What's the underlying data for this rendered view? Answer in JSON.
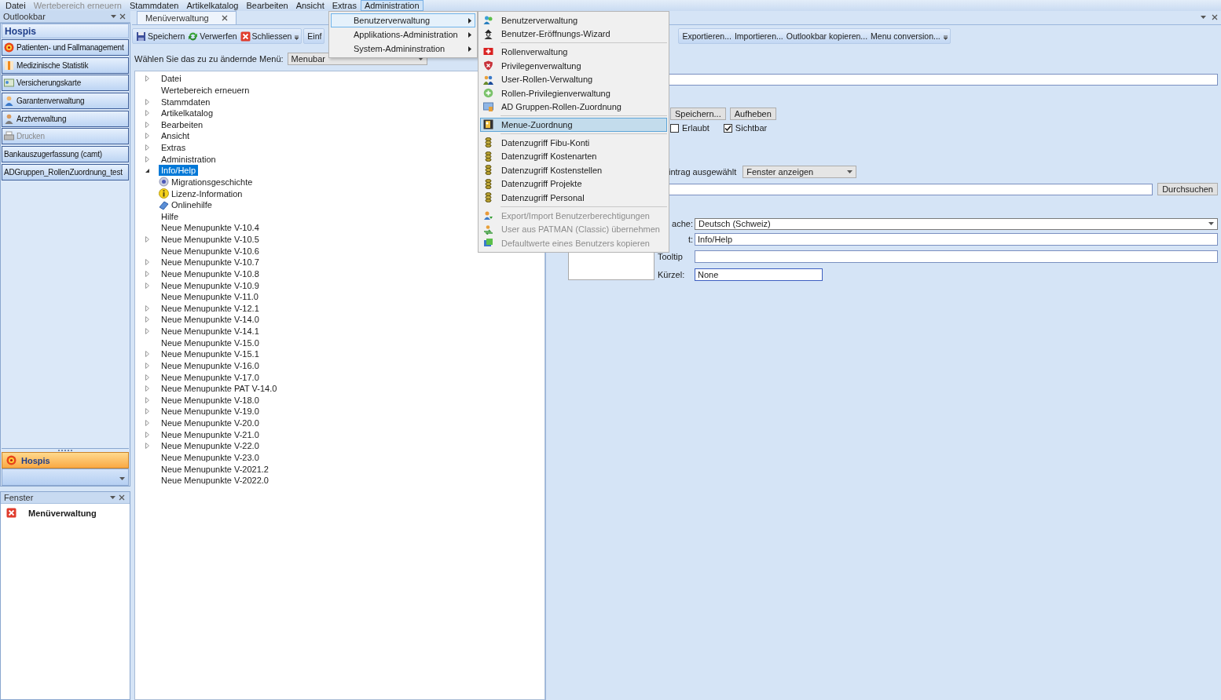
{
  "menubar": [
    {
      "label": "Datei",
      "disabled": false,
      "selected": false
    },
    {
      "label": "Wertebereich erneuern",
      "disabled": true,
      "selected": false
    },
    {
      "label": "Stammdaten",
      "disabled": false,
      "selected": false
    },
    {
      "label": "Artikelkatalog",
      "disabled": false,
      "selected": false
    },
    {
      "label": "Bearbeiten",
      "disabled": false,
      "selected": false
    },
    {
      "label": "Ansicht",
      "disabled": false,
      "selected": false
    },
    {
      "label": "Extras",
      "disabled": false,
      "selected": false
    },
    {
      "label": "Administration",
      "disabled": false,
      "selected": true
    }
  ],
  "outlookbar": {
    "title": "Outlookbar",
    "heading": "Hospis",
    "items": [
      {
        "label": "Patienten- und Fallmanagement",
        "kind": "target",
        "disabled": false
      },
      {
        "label": "Medizinische Statistik",
        "kind": "chart",
        "disabled": false
      },
      {
        "label": "Versicherungskarte",
        "kind": "card",
        "disabled": false
      },
      {
        "label": "Garantenverwaltung",
        "kind": "person",
        "disabled": false
      },
      {
        "label": "Arztverwaltung",
        "kind": "doctor",
        "disabled": false
      },
      {
        "label": "Drucken",
        "kind": "printer",
        "disabled": true
      },
      {
        "label": "Bankauszugerfassung (camt)",
        "kind": "plain",
        "disabled": false
      },
      {
        "label": "ADGruppen_RollenZuordnung_test",
        "kind": "plain",
        "disabled": false
      }
    ],
    "bottom_button": "Hospis"
  },
  "fenster": {
    "title": "Fenster",
    "items": [
      "Menüverwaltung"
    ]
  },
  "document_tab": "Menüverwaltung",
  "toolbar": {
    "groups": [
      [
        {
          "label": "Speichern",
          "kind": "save"
        },
        {
          "label": "Verwerfen",
          "kind": "discard"
        },
        {
          "label": "Schliessen",
          "kind": "close"
        }
      ],
      [
        {
          "label": "Einf",
          "kind": "plain"
        }
      ],
      [
        {
          "label": "Exportieren...",
          "kind": "plain"
        },
        {
          "label": "Importieren...",
          "kind": "plain"
        },
        {
          "label": "Outlookbar kopieren...",
          "kind": "plain"
        },
        {
          "label": "Menu conversion...",
          "kind": "plain"
        }
      ]
    ]
  },
  "menu_selector": {
    "label": "Wählen Sie das zu zu ändernde Menü:",
    "value": "Menubar"
  },
  "tree": [
    {
      "label": "Datei",
      "expanded": false,
      "selected": false
    },
    {
      "label": "Wertebereich erneuern",
      "selected": false
    },
    {
      "label": "Stammdaten",
      "expanded": false,
      "selected": false
    },
    {
      "label": "Artikelkatalog",
      "expanded": false,
      "selected": false
    },
    {
      "label": "Bearbeiten",
      "expanded": false,
      "selected": false
    },
    {
      "label": "Ansicht",
      "expanded": false,
      "selected": false
    },
    {
      "label": "Extras",
      "expanded": false,
      "selected": false
    },
    {
      "label": "Administration",
      "expanded": false,
      "selected": false
    },
    {
      "label": "Info/Help",
      "expanded": true,
      "selected": true,
      "children": [
        {
          "label": "Migrationsgeschichte",
          "kind": "disc",
          "selected": false
        },
        {
          "label": "Lizenz-Information",
          "kind": "info",
          "selected": false
        },
        {
          "label": "Onlinehilfe",
          "kind": "book",
          "selected": false
        },
        {
          "label": "Hilfe",
          "kind": "plain",
          "selected": false
        }
      ]
    },
    {
      "label": "Neue Menupunkte V-10.4",
      "selected": false
    },
    {
      "label": "Neue Menupunkte V-10.5",
      "expanded": false,
      "selected": false
    },
    {
      "label": "Neue Menupunkte V-10.6",
      "selected": false
    },
    {
      "label": "Neue Menupunkte V-10.7",
      "expanded": false,
      "selected": false
    },
    {
      "label": "Neue Menupunkte V-10.8",
      "expanded": false,
      "selected": false
    },
    {
      "label": "Neue Menupunkte V-10.9",
      "expanded": false,
      "selected": false
    },
    {
      "label": "Neue Menupunkte V-11.0",
      "selected": false
    },
    {
      "label": "Neue Menupunkte V-12.1",
      "expanded": false,
      "selected": false
    },
    {
      "label": "Neue Menupunkte V-14.0",
      "expanded": false,
      "selected": false
    },
    {
      "label": "Neue Menupunkte V-14.1",
      "expanded": false,
      "selected": false
    },
    {
      "label": "Neue Menupunkte V-15.0",
      "selected": false
    },
    {
      "label": "Neue Menupunkte V-15.1",
      "expanded": false,
      "selected": false
    },
    {
      "label": "Neue Menupunkte V-16.0",
      "expanded": false,
      "selected": false
    },
    {
      "label": "Neue Menupunkte V-17.0",
      "expanded": false,
      "selected": false
    },
    {
      "label": "Neue Menupunkte PAT V-14.0",
      "expanded": false,
      "selected": false
    },
    {
      "label": "Neue Menupunkte V-18.0",
      "expanded": false,
      "selected": false
    },
    {
      "label": "Neue Menupunkte V-19.0",
      "expanded": false,
      "selected": false
    },
    {
      "label": "Neue Menupunkte V-20.0",
      "expanded": false,
      "selected": false
    },
    {
      "label": "Neue Menupunkte V-21.0",
      "expanded": false,
      "selected": false
    },
    {
      "label": "Neue Menupunkte V-22.0",
      "expanded": false,
      "selected": false
    },
    {
      "label": "Neue Menupunkte V-23.0",
      "selected": false
    },
    {
      "label": "Neue Menupunkte V-2021.2",
      "selected": false
    },
    {
      "label": "Neue Menupunkte V-2022.0",
      "selected": false
    }
  ],
  "form": {
    "buttons": [
      "Speichern...",
      "Aufheben"
    ],
    "checkboxes": [
      {
        "label": "Erlaubt",
        "checked": false
      },
      {
        "label": "Sichtbar",
        "checked": true
      }
    ],
    "action_label": "intrag ausgewählt",
    "action_value": "Fenster anzeigen",
    "browse_button": "Durchsuchen",
    "fields": [
      {
        "label": "ache:",
        "value": "Deutsch (Schweiz)",
        "kind": "select"
      },
      {
        "label": "t:",
        "value": "Info/Help",
        "kind": "text"
      },
      {
        "label": "Tooltip",
        "kind": "text"
      },
      {
        "label": "Kürzel:",
        "value": "None",
        "kind": "short"
      }
    ]
  },
  "admin_menu": [
    {
      "label": "Benutzerverwaltung",
      "selected": true
    },
    {
      "label": "Applikations-Administration",
      "selected": false
    },
    {
      "label": "System-Admininstration",
      "selected": false
    }
  ],
  "submenu": [
    [
      {
        "label": "Benutzerverwaltung",
        "kind": "users",
        "selected": false,
        "disabled": false
      },
      {
        "label": "Benutzer-Eröffnungs-Wizard",
        "kind": "wizard",
        "selected": false,
        "disabled": false
      }
    ],
    [
      {
        "label": "Rollenverwaltung",
        "kind": "role",
        "selected": false,
        "disabled": false
      },
      {
        "label": "Privilegenverwaltung",
        "kind": "shield",
        "selected": false,
        "disabled": false
      },
      {
        "label": "User-Rollen-Verwaltung",
        "kind": "group",
        "selected": false,
        "disabled": false
      },
      {
        "label": "Rollen-Privilegienverwaltung",
        "kind": "plus",
        "selected": false,
        "disabled": false
      },
      {
        "label": "AD Gruppen-Rollen-Zuordnung",
        "kind": "monitor",
        "selected": false,
        "disabled": false
      }
    ],
    [
      {
        "label": "Menue-Zuordnung",
        "kind": "menu",
        "selected": true,
        "disabled": false
      }
    ],
    [
      {
        "label": "Datenzugriff Fibu-Konti",
        "kind": "coins",
        "selected": false,
        "disabled": false
      },
      {
        "label": "Datenzugriff Kostenarten",
        "kind": "coins",
        "selected": false,
        "disabled": false
      },
      {
        "label": "Datenzugriff Kostenstellen",
        "kind": "coins",
        "selected": false,
        "disabled": false
      },
      {
        "label": "Datenzugriff Projekte",
        "kind": "coins",
        "selected": false,
        "disabled": false
      },
      {
        "label": "Datenzugriff Personal",
        "kind": "coins",
        "selected": false,
        "disabled": false
      }
    ],
    [
      {
        "label": "Export/Import Benutzerberechtigungen",
        "kind": "export",
        "selected": false,
        "disabled": true
      },
      {
        "label": "User aus PATMAN (Classic) übernehmen",
        "kind": "transfer",
        "selected": false,
        "disabled": true
      },
      {
        "label": "Defaultwerte eines Benutzers kopieren",
        "kind": "copy",
        "selected": false,
        "disabled": true
      }
    ]
  ]
}
